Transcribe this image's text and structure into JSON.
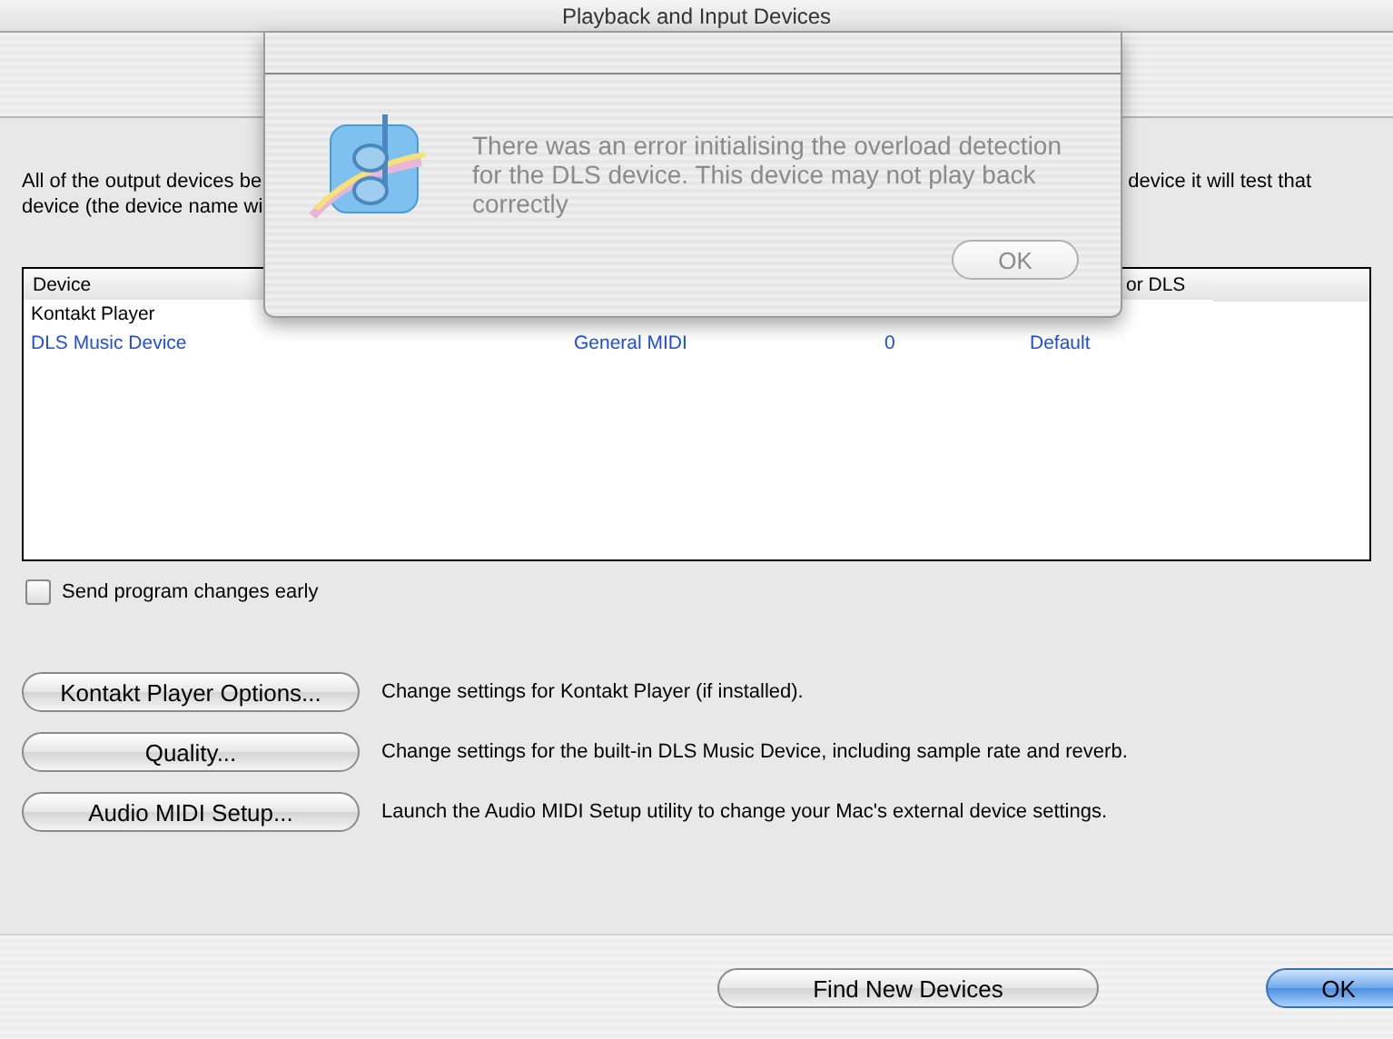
{
  "window": {
    "title": "Playback and Input Devices"
  },
  "intro": {
    "lines": [
      {
        "left": "All of the output devices be",
        "right": "device it will test that"
      },
      {
        "left": "device (the device name wi"
      }
    ]
  },
  "table": {
    "columns": [
      "Device",
      "or DLS"
    ],
    "rows": [
      {
        "cells": [
          "Kontakt Player"
        ],
        "selected": false
      },
      {
        "cells": [
          "DLS Music Device",
          "General MIDI",
          "0",
          "Default"
        ],
        "selected": true
      }
    ]
  },
  "send_program_changes_early": {
    "label": "Send program changes early",
    "checked": false
  },
  "actions": [
    {
      "button": "Kontakt Player Options...",
      "description": "Change settings for Kontakt Player (if installed)."
    },
    {
      "button": "Quality...",
      "description": "Change settings for the built-in DLS Music Device, including sample rate and reverb."
    },
    {
      "button": "Audio MIDI Setup...",
      "description": "Launch the Audio MIDI Setup utility to change your Mac's external device settings."
    }
  ],
  "footer_buttons": [
    {
      "label": "Find New Devices",
      "default": false
    },
    {
      "label": "OK",
      "default": true
    }
  ],
  "alert": {
    "message": "There was an error initialising the overload detection for the DLS device. This device may not play back correctly",
    "button": "OK"
  }
}
